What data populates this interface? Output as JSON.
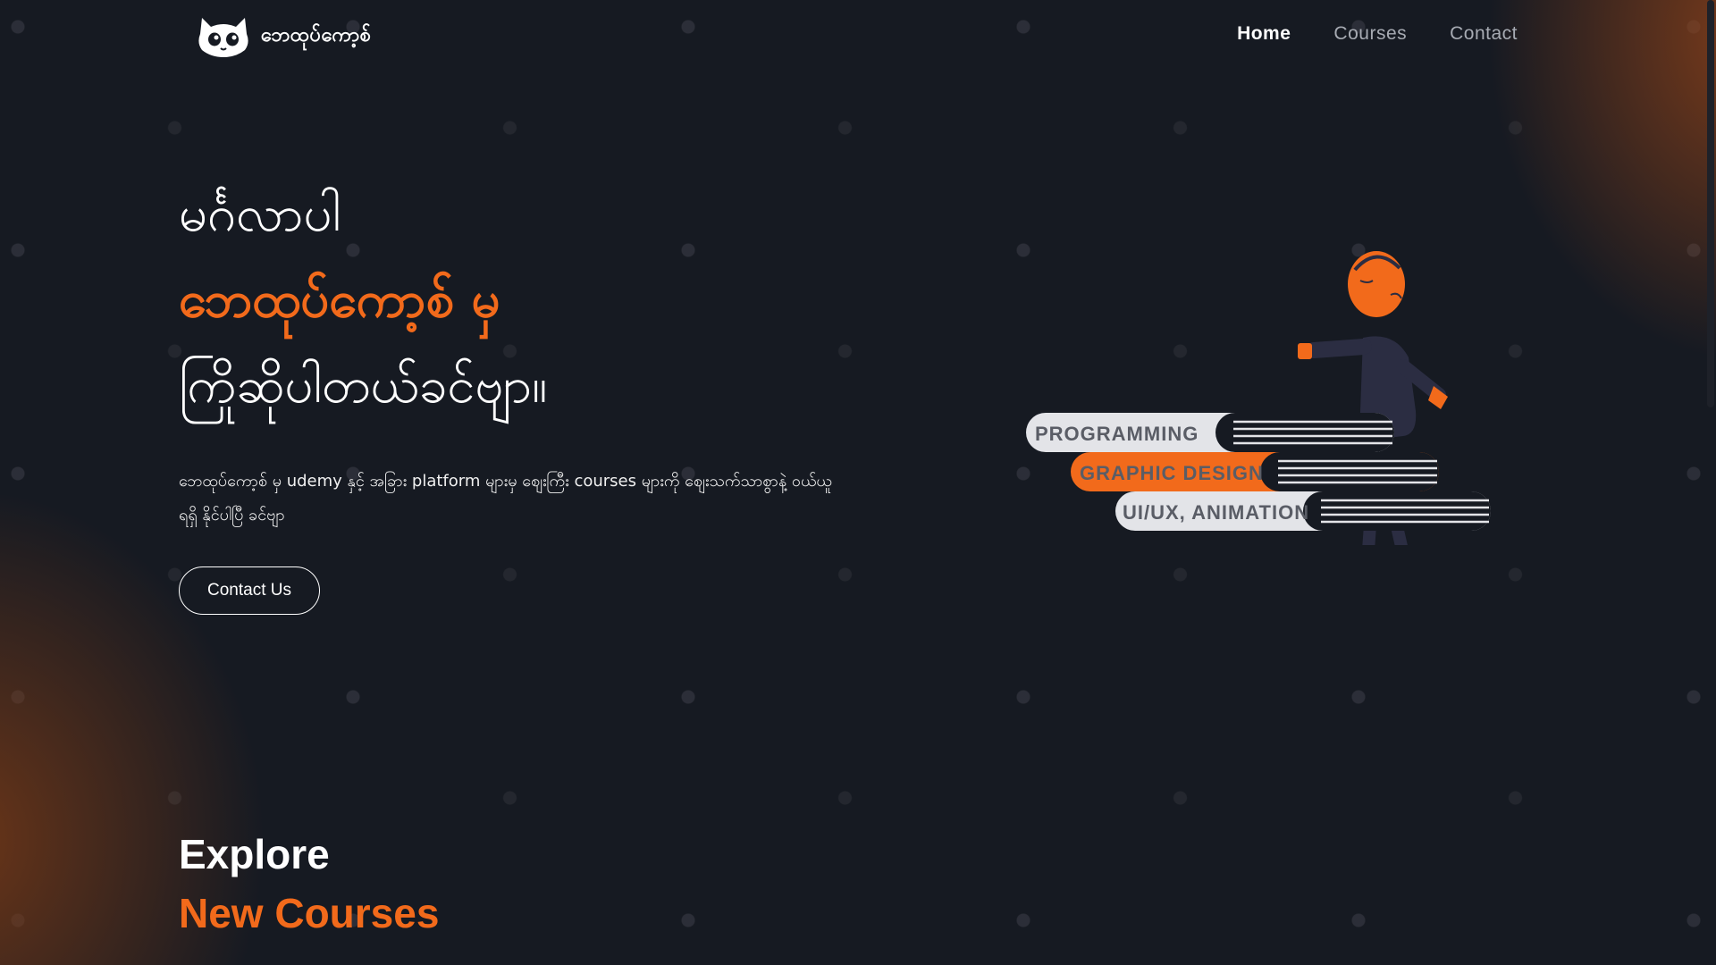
{
  "brand": {
    "name": "ဘေထုပ်ကော့စ်",
    "logo_icon": "cat-face-logo"
  },
  "nav": {
    "home": "Home",
    "courses": "Courses",
    "contact": "Contact"
  },
  "hero": {
    "line1": "မင်္ဂလာပါ",
    "line2": "ဘေထုပ်ကော့စ် မှ",
    "line3": "ကြိုဆိုပါတယ်ခင်ဗျာ။",
    "description": "ဘေထုပ်ကော့စ် မှ udemy နှင့် အခြား platform များမှ စျေးကြီး courses များကို စျေးသက်သာစွာနဲ့ ဝယ်ယူရရှိ နိုင်ပါပြီ ခင်ဗျာ",
    "contact_button": "Contact Us"
  },
  "illustration": {
    "books": [
      "PROGRAMMING",
      "GRAPHIC DESIGN",
      "UI/UX, ANIMATION"
    ]
  },
  "explore": {
    "title": "Explore",
    "subtitle": "New Courses"
  },
  "colors": {
    "accent": "#f26a1b",
    "background": "#161a22",
    "book_light": "#e3e4e8",
    "figure_body": "#2b2d42"
  }
}
